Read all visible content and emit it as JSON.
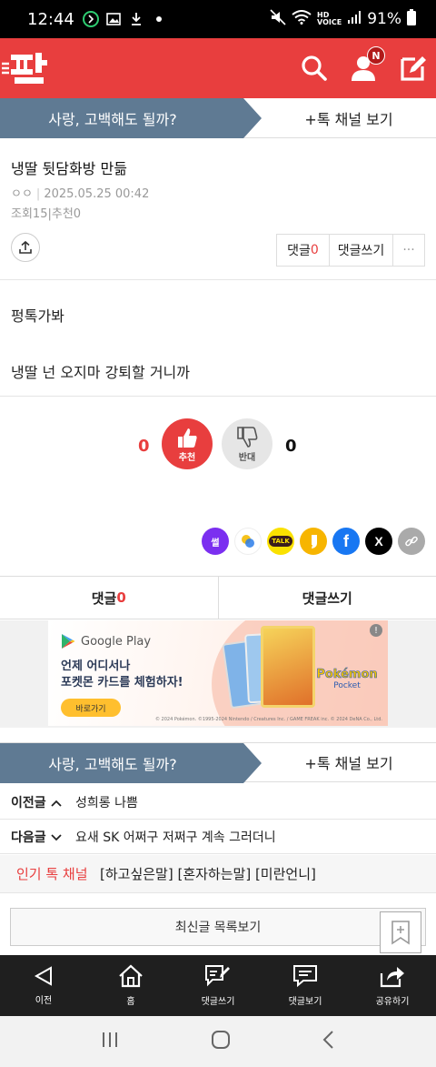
{
  "status_bar": {
    "time": "12:44",
    "battery": "91%"
  },
  "channel": {
    "name": "사랑, 고백해도 될까?",
    "more": "+톡 채널 보기"
  },
  "appbar": {
    "badge": "N"
  },
  "post": {
    "title": "냉딸 뒷담화방 만듦",
    "author": "ㅇㅇ",
    "date": "2025.05.25 00:42",
    "views_label": "조회",
    "views": "15",
    "recommend_label": "추천",
    "recommend": "0",
    "body": [
      "펑톡가봐",
      "냉딸 넌 오지마 강퇴할 거니까"
    ]
  },
  "actions": {
    "comment_label": "댓글",
    "comment_count": "0",
    "write_comment": "댓글쓰기",
    "more": "···"
  },
  "vote": {
    "up_count": "0",
    "up_label": "추천",
    "down_label": "반대",
    "down_count": "0"
  },
  "sns": [
    {
      "name": "ssul-icon",
      "label": "썰",
      "color": "#7b2ff0"
    },
    {
      "name": "band-icon",
      "label": "",
      "color": "#ffffff"
    },
    {
      "name": "kakaotalk-icon",
      "label": "TALK",
      "color": "#fae100"
    },
    {
      "name": "kakaostory-icon",
      "label": "",
      "color": "#f7b500"
    },
    {
      "name": "facebook-icon",
      "label": "f",
      "color": "#1877f2"
    },
    {
      "name": "x-icon",
      "label": "X",
      "color": "#000000"
    },
    {
      "name": "link-icon",
      "label": "",
      "color": "#aaaaaa"
    }
  ],
  "comment_bar": {
    "comments": "댓글",
    "count": "0",
    "write": "댓글쓰기"
  },
  "ad": {
    "store": "Google Play",
    "line1": "언제 어디서나",
    "line2": "포켓몬 카드를 체험하자!",
    "cta": "바로가기",
    "brand": "Pokémon",
    "brand_sub": "Pocket",
    "legal": "© 2024 Pokémon. ©1995-2024 Nintendo / Creatures Inc. / GAME FREAK inc. © 2024 DeNA Co., Ltd."
  },
  "prev": {
    "label": "이전글",
    "title": "성희롱 나쁨"
  },
  "next": {
    "label": "다음글",
    "title": "요새 SK 어쩌구 저쩌구 계속 그러더니"
  },
  "hot": {
    "label": "인기 톡 채널",
    "items": "[하고싶은말] [혼자하는말] [미란언니]"
  },
  "latest": "최신글 목록보기",
  "bottom_nav": [
    {
      "name": "back",
      "label": "이전"
    },
    {
      "name": "home",
      "label": "홈"
    },
    {
      "name": "write-comment",
      "label": "댓글쓰기"
    },
    {
      "name": "view-comments",
      "label": "댓글보기"
    },
    {
      "name": "share",
      "label": "공유하기"
    }
  ]
}
